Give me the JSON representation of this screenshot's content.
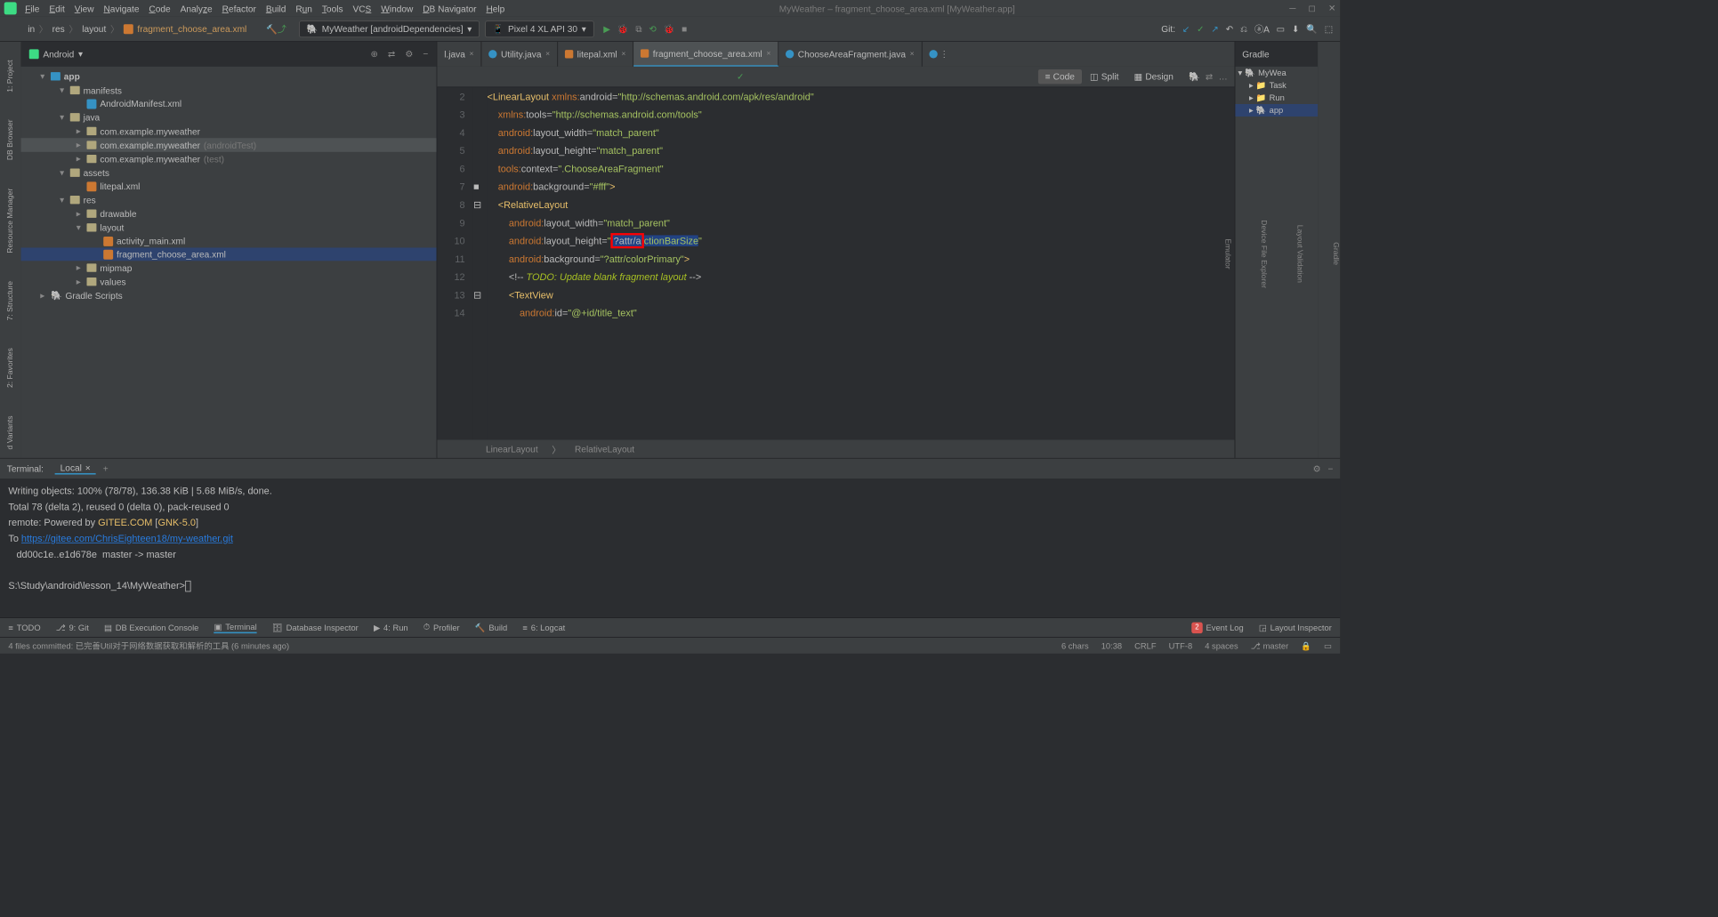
{
  "window": {
    "title": "MyWeather – fragment_choose_area.xml [MyWeather.app]"
  },
  "mainmenu": [
    "File",
    "Edit",
    "View",
    "Navigate",
    "Code",
    "Analyze",
    "Refactor",
    "Build",
    "Run",
    "Tools",
    "VCS",
    "Window",
    "DB Navigator",
    "Help"
  ],
  "breadcrumb": {
    "parts": [
      "in",
      "res",
      "layout"
    ],
    "file": "fragment_choose_area.xml"
  },
  "run_config": "MyWeather [androidDependencies]",
  "device": "Pixel 4 XL API 30",
  "git_label": "Git:",
  "project_selector": "Android",
  "tree": {
    "app": "app",
    "manifests": "manifests",
    "manifest_file": "AndroidManifest.xml",
    "java": "java",
    "pkg_main": "com.example.myweather",
    "pkg_test": "com.example.myweather",
    "pkg_test_suffix": " (androidTest)",
    "pkg_unit": "com.example.myweather",
    "pkg_unit_suffix": " (test)",
    "assets": "assets",
    "litepal": "litepal.xml",
    "res": "res",
    "drawable": "drawable",
    "layout": "layout",
    "activity_main": "activity_main.xml",
    "fragment": "fragment_choose_area.xml",
    "mipmap": "mipmap",
    "values": "values",
    "gradle_scripts": "Gradle Scripts"
  },
  "tabs": [
    {
      "label": "l.java",
      "icon": "java"
    },
    {
      "label": "Utility.java",
      "icon": "java"
    },
    {
      "label": "litepal.xml",
      "icon": "xml"
    },
    {
      "label": "fragment_choose_area.xml",
      "icon": "xml",
      "active": true
    },
    {
      "label": "ChooseAreaFragment.java",
      "icon": "java"
    }
  ],
  "viewmode": {
    "code": "Code",
    "split": "Split",
    "design": "Design"
  },
  "gradle": {
    "title": "Gradle",
    "root": "MyWea",
    "tasks": "Task",
    "run": "Run",
    "app": "app"
  },
  "code_lines": {
    "start": 2,
    "end": 14
  },
  "code": {
    "xmlns_android": "http://schemas.android.com/apk/res/android",
    "xmlns_tools": "http://schemas.android.com/tools",
    "match_parent": "match_parent",
    "context": ".ChooseAreaFragment",
    "bg": "#fff",
    "actionbar": "?attr/actionBarSize",
    "colorprimary": "?attr/colorPrimary",
    "todo": "TODO: Update blank fragment layout",
    "titleid": "@+id/title_text"
  },
  "breadcrumb_code": [
    "LinearLayout",
    "RelativeLayout"
  ],
  "terminal": {
    "label": "Terminal:",
    "tab": "Local",
    "l1": "Writing objects: 100% (78/78), 136.38 KiB | 5.68 MiB/s, done.",
    "l2": "Total 78 (delta 2), reused 0 (delta 0), pack-reused 0",
    "l3_pre": "remote: Powered by ",
    "l3_gitee": "GITEE.COM",
    "l3_mid": " [",
    "l3_gnk": "GNK-5.0",
    "l3_end": "]",
    "l4_pre": "To ",
    "l4_url": "https://gitee.com/ChrisEighteen18/my-weather.git",
    "l5": "   dd00c1e..e1d678e  master -> master",
    "prompt": "S:\\Study\\android\\lesson_14\\MyWeather>"
  },
  "bottombar": {
    "todo": "TODO",
    "git": "9: Git",
    "db": "DB Execution Console",
    "terminal": "Terminal",
    "dbinsp": "Database Inspector",
    "run": "4: Run",
    "profiler": "Profiler",
    "build": "Build",
    "logcat": "6: Logcat",
    "eventlog": "Event Log",
    "eventcount": "2",
    "layoutinsp": "Layout Inspector"
  },
  "status": {
    "msg": "4 files committed: 已完善Util对于网络数据获取和解析的工具 (6 minutes ago)",
    "chars": "6 chars",
    "pos": "10:38",
    "le": "CRLF",
    "enc": "UTF-8",
    "indent": "4 spaces",
    "branch": "master"
  },
  "leftpanels": [
    "1: Project",
    "DB Browser",
    "Resource Manager",
    "7: Structure",
    "2: Favorites",
    "d Variants"
  ],
  "rightpanels": [
    "Gradle",
    "Layout Validation",
    "Device File Explorer",
    "Emulator"
  ]
}
